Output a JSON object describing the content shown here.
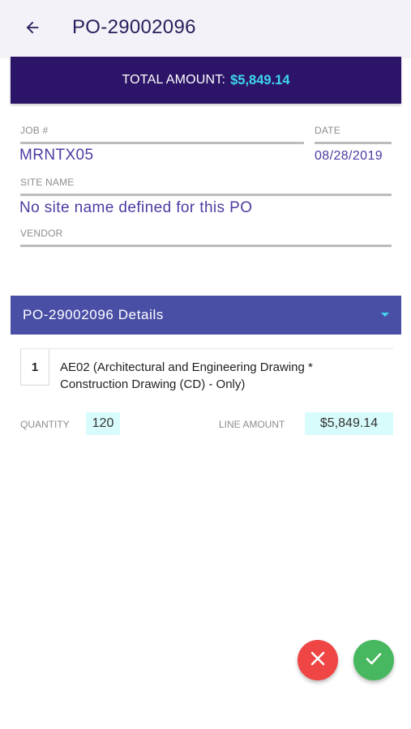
{
  "header": {
    "title": "PO-29002096",
    "back_icon": "arrow-left-icon"
  },
  "total": {
    "label": "TOTAL AMOUNT:",
    "amount": "$5,849.14"
  },
  "fields": {
    "job_label": "JOB #",
    "job_value": "MRNTX05",
    "date_label": "DATE",
    "date_value": "08/28/2019",
    "site_label": "SITE NAME",
    "site_value": "No site name defined for this PO",
    "vendor_label": "VENDOR",
    "vendor_value": ""
  },
  "details": {
    "title": "PO-29002096 Details",
    "expand_icon": "caret-down-icon",
    "items": [
      {
        "number": "1",
        "description": "AE02 (Architectural and Engineering Drawing * Construction Drawing (CD) - Only)",
        "quantity_label": "QUANTITY",
        "quantity": "120",
        "line_amount_label": "LINE AMOUNT",
        "line_amount": "$5,849.14"
      }
    ]
  },
  "actions": {
    "reject_icon": "close-icon",
    "approve_icon": "check-icon"
  },
  "colors": {
    "banner": "#2c1568",
    "accent": "#3fd6ee",
    "section_header": "#4a4fa6",
    "value_text": "#4e3ba3",
    "reject": "#ef4545",
    "approve": "#47b85f",
    "highlight": "#d8fbfb"
  }
}
